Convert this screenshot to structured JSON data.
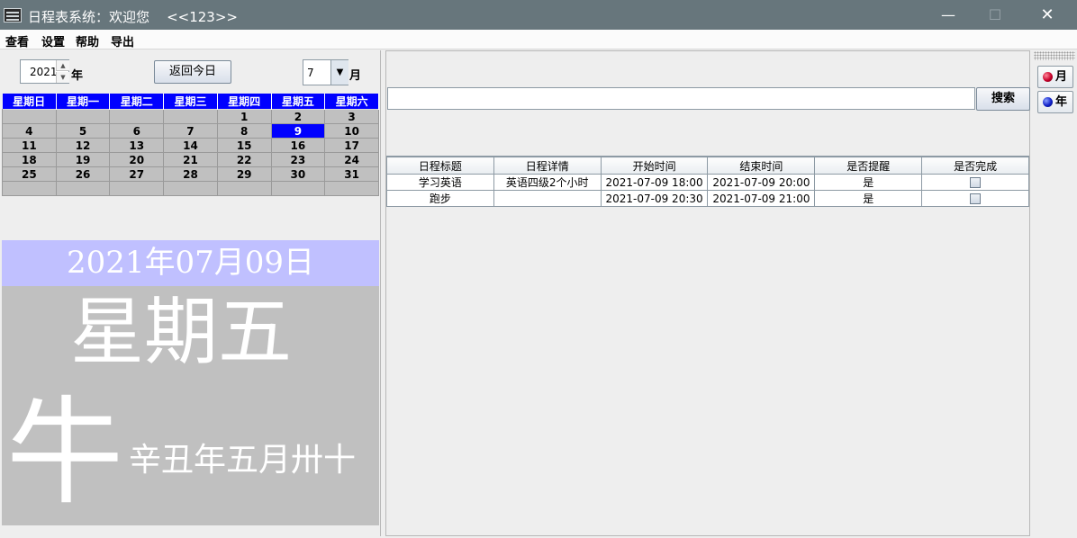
{
  "window": {
    "title": "日程表系统：欢迎您    <<123>>",
    "controls": {
      "minimize": "—",
      "maximize": "☐",
      "close": "✕"
    }
  },
  "menu": [
    "查看",
    "设置",
    "帮助",
    "导出"
  ],
  "calendar_controls": {
    "year_value": "2021",
    "year_unit": "年",
    "today_button": "返回今日",
    "month_value": "7",
    "month_unit": "月"
  },
  "calendar": {
    "weekday_headers": [
      "星期日",
      "星期一",
      "星期二",
      "星期三",
      "星期四",
      "星期五",
      "星期六"
    ],
    "weeks": [
      [
        "",
        "",
        "",
        "",
        "1",
        "2",
        "3"
      ],
      [
        "4",
        "5",
        "6",
        "7",
        "8",
        "9",
        "10"
      ],
      [
        "11",
        "12",
        "13",
        "14",
        "15",
        "16",
        "17"
      ],
      [
        "18",
        "19",
        "20",
        "21",
        "22",
        "23",
        "24"
      ],
      [
        "25",
        "26",
        "27",
        "28",
        "29",
        "30",
        "31"
      ],
      [
        "",
        "",
        "",
        "",
        "",
        "",
        ""
      ]
    ],
    "selected_day": "9",
    "selected_color": "#0000ff"
  },
  "today_display": {
    "date": "2021年07月09日",
    "weekday": "星期五",
    "zodiac": "牛",
    "lunar": "辛丑年五月卅十"
  },
  "search": {
    "placeholder": "",
    "button_label": "搜索"
  },
  "schedule_table": {
    "columns": [
      "日程标题",
      "日程详情",
      "开始时间",
      "结束时间",
      "是否提醒",
      "是否完成"
    ],
    "rows": [
      {
        "title": "学习英语",
        "detail": "英语四级2个小时",
        "start": "2021-07-09 18:00",
        "end": "2021-07-09 20:00",
        "remind": "是",
        "done": false
      },
      {
        "title": "跑步",
        "detail": "",
        "start": "2021-07-09 20:30",
        "end": "2021-07-09 21:00",
        "remind": "是",
        "done": false
      }
    ]
  },
  "side_buttons": {
    "month_view": "月",
    "year_view": "年"
  }
}
